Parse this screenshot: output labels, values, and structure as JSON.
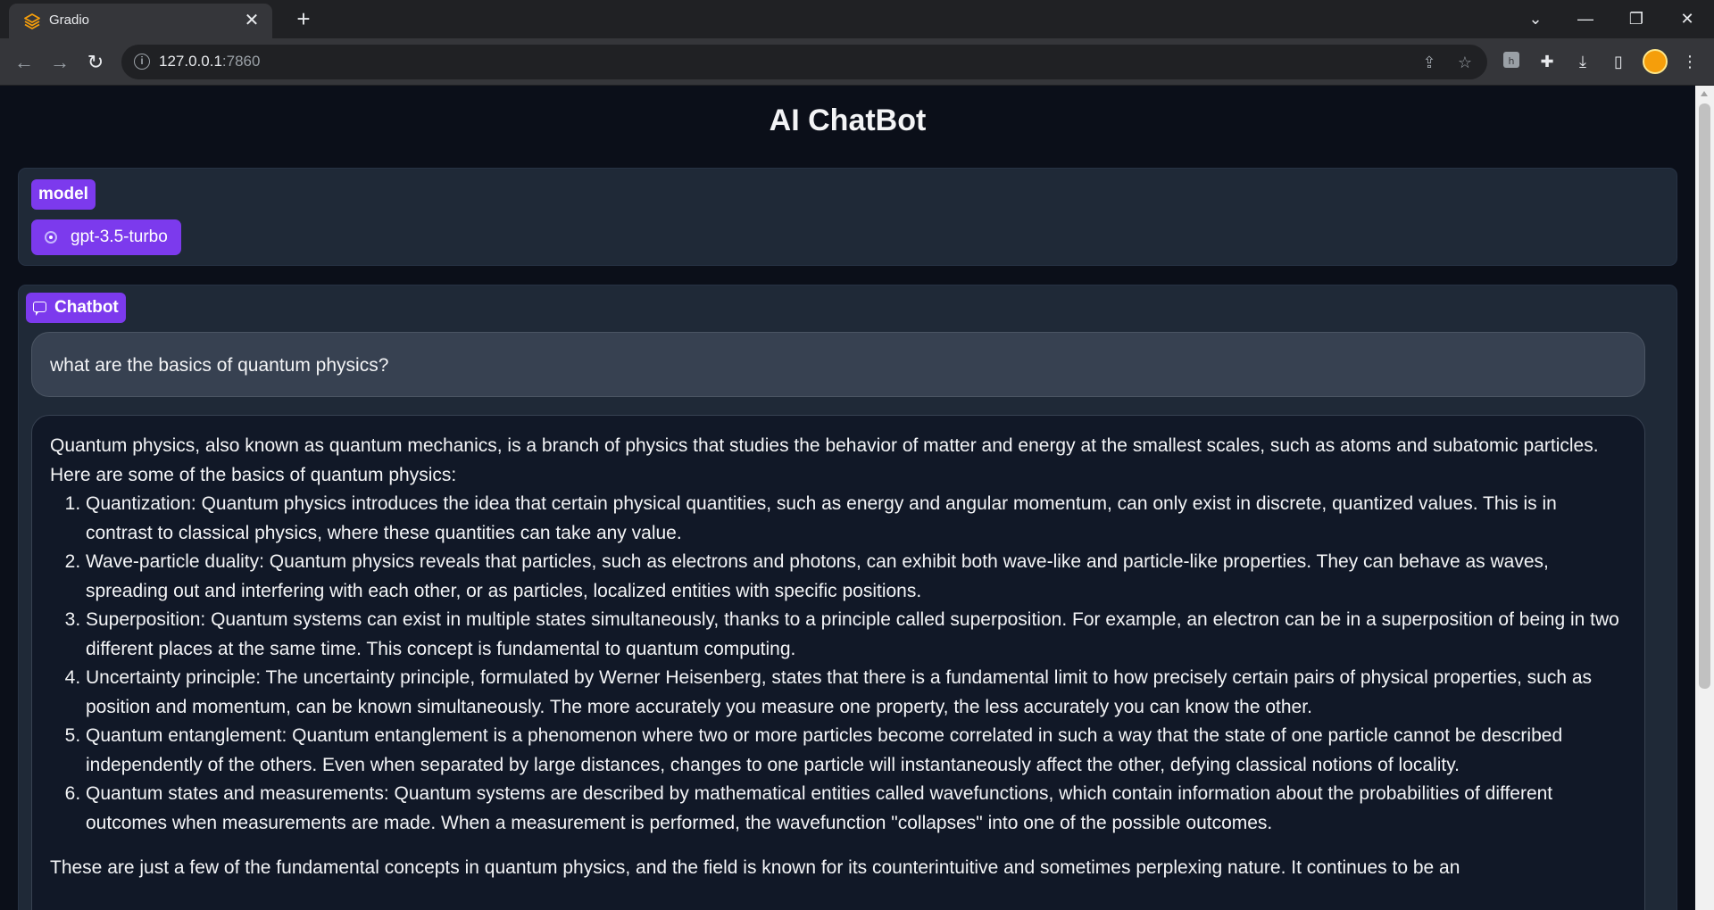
{
  "browser": {
    "tab_title": "Gradio",
    "url_host": "127.0.0.1",
    "url_port": ":7860"
  },
  "app": {
    "title": "AI ChatBot"
  },
  "model_panel": {
    "label": "model",
    "options": [
      "gpt-3.5-turbo"
    ],
    "selected": "gpt-3.5-turbo"
  },
  "chatbot": {
    "label": "Chatbot",
    "user_message": "what are the basics of quantum physics?",
    "bot_intro": "Quantum physics, also known as quantum mechanics, is a branch of physics that studies the behavior of matter and energy at the smallest scales, such as atoms and subatomic particles. Here are some of the basics of quantum physics:",
    "bot_items": [
      "Quantization: Quantum physics introduces the idea that certain physical quantities, such as energy and angular momentum, can only exist in discrete, quantized values. This is in contrast to classical physics, where these quantities can take any value.",
      "Wave-particle duality: Quantum physics reveals that particles, such as electrons and photons, can exhibit both wave-like and particle-like properties. They can behave as waves, spreading out and interfering with each other, or as particles, localized entities with specific positions.",
      "Superposition: Quantum systems can exist in multiple states simultaneously, thanks to a principle called superposition. For example, an electron can be in a superposition of being in two different places at the same time. This concept is fundamental to quantum computing.",
      "Uncertainty principle: The uncertainty principle, formulated by Werner Heisenberg, states that there is a fundamental limit to how precisely certain pairs of physical properties, such as position and momentum, can be known simultaneously. The more accurately you measure one property, the less accurately you can know the other.",
      "Quantum entanglement: Quantum entanglement is a phenomenon where two or more particles become correlated in such a way that the state of one particle cannot be described independently of the others. Even when separated by large distances, changes to one particle will instantaneously affect the other, defying classical notions of locality.",
      "Quantum states and measurements: Quantum systems are described by mathematical entities called wavefunctions, which contain information about the probabilities of different outcomes when measurements are made. When a measurement is performed, the wavefunction \"collapses\" into one of the possible outcomes."
    ],
    "bot_outro": "These are just a few of the fundamental concepts in quantum physics, and the field is known for its counterintuitive and sometimes perplexing nature. It continues to be an"
  },
  "colors": {
    "accent": "#7c3aed",
    "page_bg": "#0b0f19",
    "panel_bg": "#1f2937",
    "user_bubble": "#374151",
    "bot_bubble": "#111827"
  },
  "icons": {
    "tab_favicon": "gradio-logo-icon",
    "close_tab": "close-icon",
    "new_tab": "plus-icon",
    "back": "arrow-left-icon",
    "forward": "arrow-right-icon",
    "reload": "reload-icon",
    "site_info": "info-icon",
    "share": "share-icon",
    "bookmark": "star-icon",
    "chatbot_label": "chat-bubble-icon"
  }
}
